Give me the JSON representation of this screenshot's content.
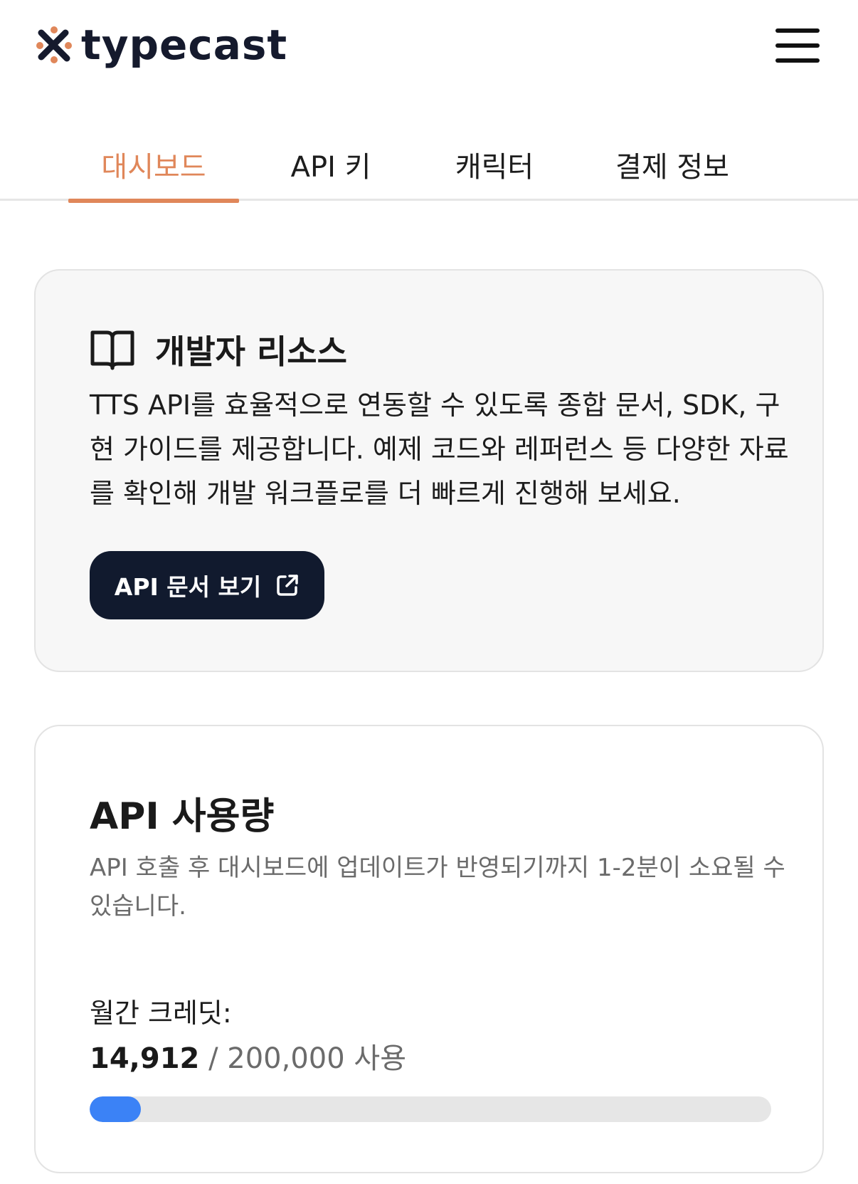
{
  "header": {
    "logo_text": "typecast",
    "menu_icon": "hamburger-menu-icon"
  },
  "tabs": [
    {
      "label": "대시보드",
      "active": true
    },
    {
      "label": "API 키",
      "active": false
    },
    {
      "label": "캐릭터",
      "active": false
    },
    {
      "label": "결제 정보",
      "active": false
    }
  ],
  "resources": {
    "icon": "book-icon",
    "title": "개발자 리소스",
    "description": "TTS API를 효율적으로 연동할 수 있도록 종합 문서, SDK, 구현 가이드를 제공합니다. 예제 코드와 레퍼런스 등 다양한 자료를 확인해 개발 워크플로를 더 빠르게 진행해 보세요.",
    "button_label": "API 문서 보기",
    "button_icon": "external-link-icon"
  },
  "usage": {
    "title": "API 사용량",
    "note": "API 호출 후 대시보드에 업데이트가 반영되기까지 1-2분이 소요될 수 있습니다.",
    "credit_label": "월간 크레딧:",
    "used": "14,912",
    "total_text": "/ 200,000 사용",
    "progress_fraction": 0.0746
  },
  "colors": {
    "accent": "#e0875a",
    "button_bg": "#111a2e",
    "progress": "#3b82f6"
  }
}
